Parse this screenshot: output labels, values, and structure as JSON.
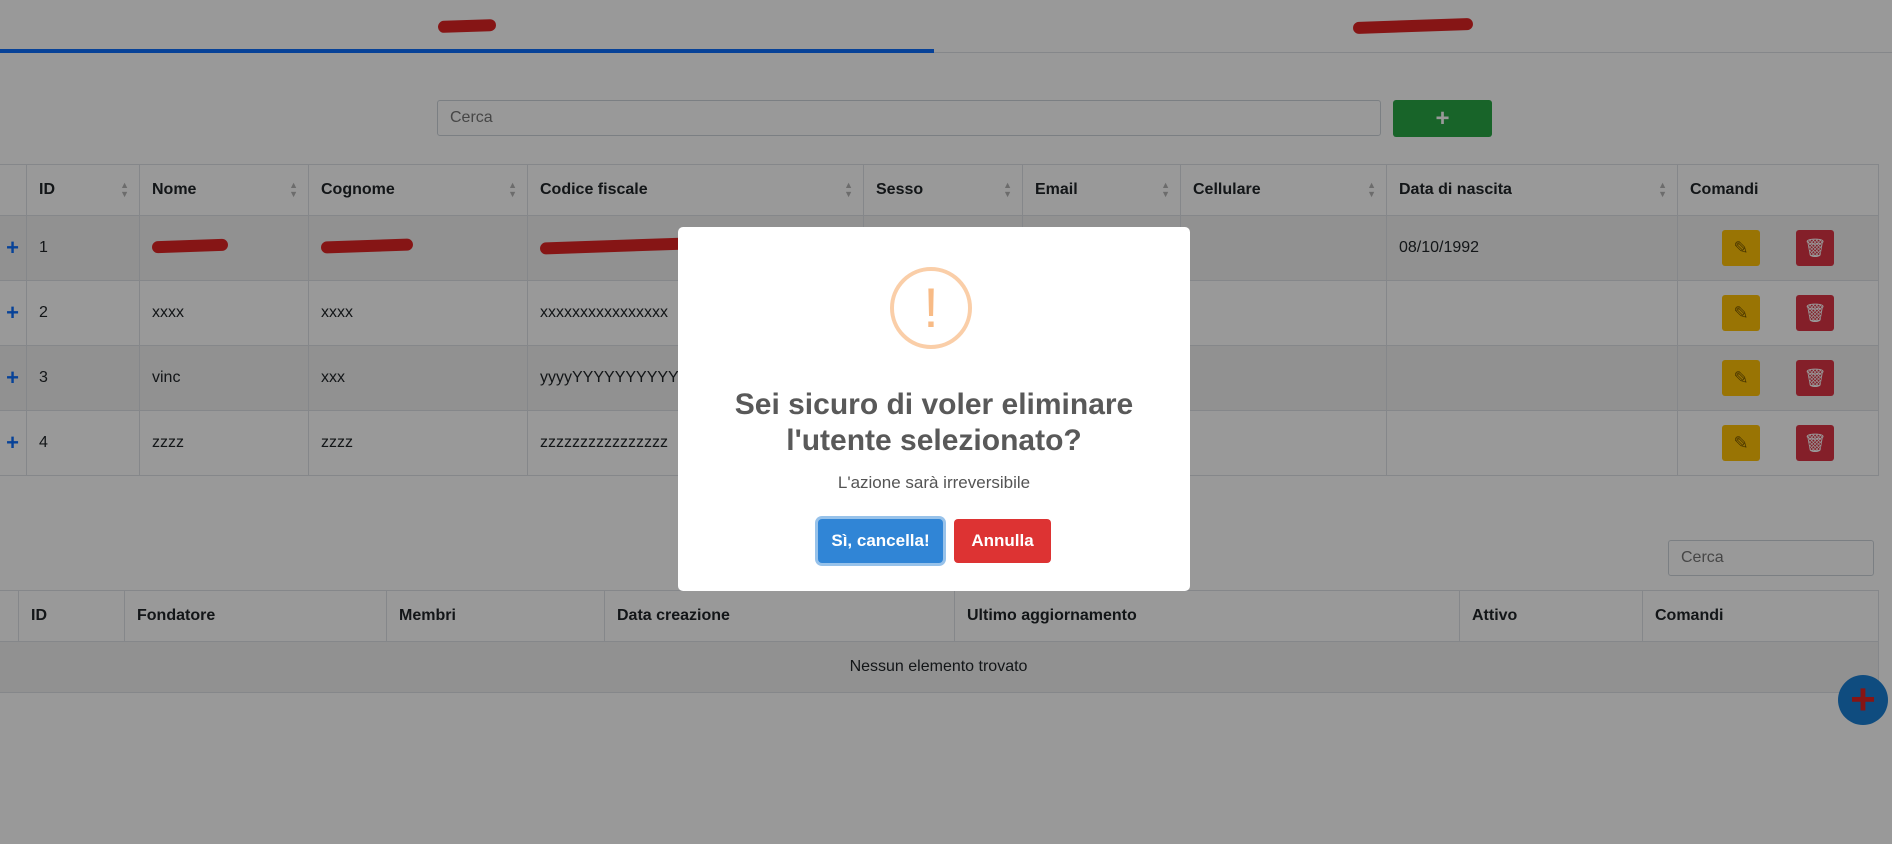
{
  "search": {
    "placeholder": "Cerca"
  },
  "toolbar": {
    "add_label": "+"
  },
  "users_table": {
    "headers": [
      "ID",
      "Nome",
      "Cognome",
      "Codice fiscale",
      "Sesso",
      "Email",
      "Cellulare",
      "Data di nascita",
      "Comandi"
    ],
    "expand_icon": "+",
    "rows": [
      {
        "id": "1",
        "nome": "",
        "cognome": "",
        "codice_fiscale": "",
        "sesso": "",
        "email": "",
        "cellulare": "",
        "data_nascita": "08/10/1992"
      },
      {
        "id": "2",
        "nome": "xxxx",
        "cognome": "xxxx",
        "codice_fiscale": "xxxxxxxxxxxxxxxx",
        "sesso": "",
        "email": "",
        "cellulare": "",
        "data_nascita": ""
      },
      {
        "id": "3",
        "nome": "vinc",
        "cognome": "xxx",
        "codice_fiscale": "yyyyYYYYYYYYYYYY",
        "sesso": "",
        "email": "",
        "cellulare": "",
        "data_nascita": ""
      },
      {
        "id": "4",
        "nome": "zzzz",
        "cognome": "zzzz",
        "codice_fiscale": "zzzzzzzzzzzzzzzz",
        "sesso": "",
        "email": "",
        "cellulare": "",
        "data_nascita": ""
      }
    ]
  },
  "groups": {
    "search_placeholder": "Cerca",
    "headers": [
      "ID",
      "Fondatore",
      "Membri",
      "Data creazione",
      "Ultimo aggiornamento",
      "Attivo",
      "Comandi"
    ],
    "empty_text": "Nessun elemento trovato"
  },
  "fab": {
    "label": "+"
  },
  "modal": {
    "icon": "!",
    "title_line1": "Sei sicuro di voler eliminare",
    "title_line2": "l'utente selezionato?",
    "text": "L'azione sarà irreversibile",
    "confirm_label": "Sì, cancella!",
    "cancel_label": "Annulla"
  },
  "colors": {
    "tab_active": "#0d6efd",
    "add_button": "#28a745",
    "edit_button": "#ffc107",
    "delete_button": "#dc3545",
    "confirm_button": "#3085d6",
    "cancel_button": "#dd3333",
    "warning_icon": "#f8bb86"
  },
  "icons": {
    "edit": "pencil-icon",
    "delete": "trash-icon",
    "warning": "exclamation-icon",
    "sort": "sort-icon",
    "expand": "plus-icon"
  }
}
